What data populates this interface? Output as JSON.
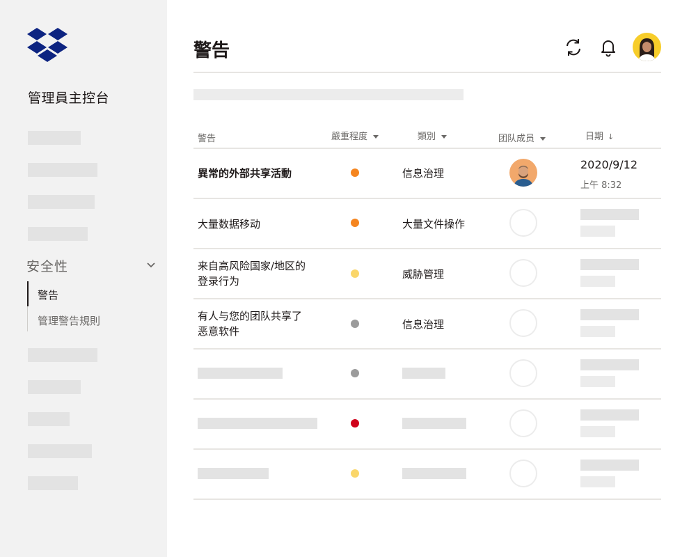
{
  "sidebar": {
    "console_title": "管理員主控台",
    "section": {
      "label": "安全性",
      "expanded": true
    },
    "sub_items": [
      {
        "label": "警告",
        "active": true
      },
      {
        "label": "管理警告規則",
        "active": false
      }
    ]
  },
  "header": {
    "title": "警告",
    "icons": [
      "refresh-icon",
      "bell-icon",
      "user-avatar"
    ]
  },
  "table": {
    "columns": [
      {
        "label": "警告",
        "sort": "none"
      },
      {
        "label": "嚴重程度",
        "sort": "caret"
      },
      {
        "label": "類別",
        "sort": "caret"
      },
      {
        "label": "团队成员",
        "sort": "caret"
      },
      {
        "label": "日期",
        "sort": "descending"
      }
    ],
    "rows": [
      {
        "alert": "異常的外部共享活動",
        "severity_color": "#f5851f",
        "category": "信息治理",
        "member": "avatar",
        "date": "2020/9/12",
        "time": "上午 8:32"
      },
      {
        "alert": "大量数据移动",
        "severity_color": "#f5851f",
        "category": "大量文件操作"
      },
      {
        "alert_line1": "来自高风险国家/地区的",
        "alert_line2": "登录行为",
        "severity_color": "#fad66a",
        "category": "威胁管理"
      },
      {
        "alert_line1": "有人与您的团队共享了",
        "alert_line2": "恶意软件",
        "severity_color": "#9b9b9b",
        "category": "信息治理"
      },
      {
        "severity_color": "#9b9b9b"
      },
      {
        "severity_color": "#d0021b"
      },
      {
        "severity_color": "#fad66a"
      }
    ]
  },
  "colors": {
    "accent_blue": "#0d2481",
    "sidebar_bg": "#f2f2f2",
    "placeholder": "#e3e3e3"
  }
}
